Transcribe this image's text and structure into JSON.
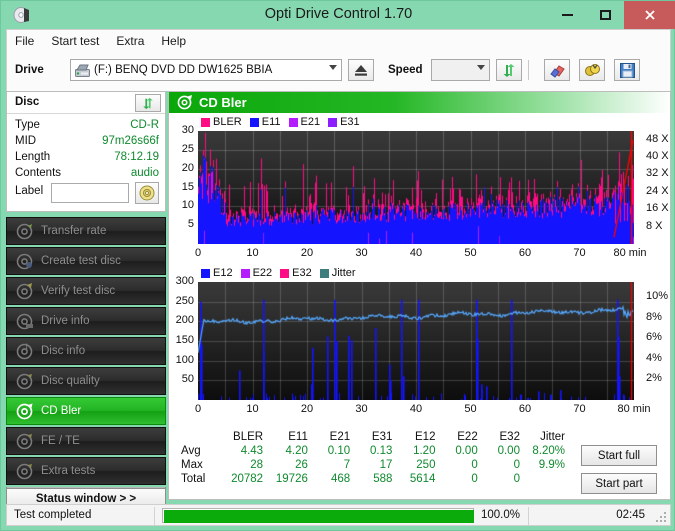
{
  "window": {
    "title": "Opti Drive Control 1.70",
    "icon": "disc-icon",
    "minimize": "–",
    "maximize": "□",
    "close": "✕"
  },
  "menu": {
    "items": [
      "File",
      "Start test",
      "Extra",
      "Help"
    ]
  },
  "toolbar": {
    "drive_label": "Drive",
    "drive_value": "(F:)  BENQ DVD DD DW1625 BBIA",
    "eject_icon": "eject-icon",
    "speed_label": "Speed",
    "speed_value": "",
    "refresh_icon": "refresh-icon",
    "eraser_icon": "eraser-icon",
    "coins_icon": "coins-icon",
    "save_icon": "floppy-save-icon"
  },
  "disc": {
    "header": "Disc",
    "swap_icon": "swap-arrows-icon",
    "rows": [
      {
        "key": "Type",
        "value": "CD-R"
      },
      {
        "key": "MID",
        "value": "97m26s66f"
      },
      {
        "key": "Length",
        "value": "78:12.19"
      },
      {
        "key": "Contents",
        "value": "audio"
      }
    ],
    "label_key": "Label",
    "label_value": "",
    "label_button_icon": "disc-icon"
  },
  "nav": {
    "items": [
      {
        "label": "Transfer rate",
        "icon": "disc-icon",
        "active": false
      },
      {
        "label": "Create test disc",
        "icon": "disc-icon",
        "active": false
      },
      {
        "label": "Verify test disc",
        "icon": "disc-icon",
        "active": false
      },
      {
        "label": "Drive info",
        "icon": "disc-icon",
        "active": false
      },
      {
        "label": "Disc info",
        "icon": "disc-icon",
        "active": false
      },
      {
        "label": "Disc quality",
        "icon": "disc-icon",
        "active": false
      },
      {
        "label": "CD Bler",
        "icon": "disc-icon",
        "active": true
      },
      {
        "label": "FE / TE",
        "icon": "disc-icon",
        "active": false
      },
      {
        "label": "Extra tests",
        "icon": "disc-icon",
        "active": false
      }
    ],
    "status_window": "Status window > >"
  },
  "main": {
    "header": "CD Bler",
    "header_icon": "disc-icon",
    "start_full": "Start full",
    "start_part": "Start part"
  },
  "statusbar": {
    "text": "Test completed",
    "percent_label": "100.0%",
    "percent_value": 100.0,
    "time": "02:45"
  },
  "stats": {
    "columns": [
      "BLER",
      "E11",
      "E21",
      "E31",
      "E12",
      "E22",
      "E32",
      "Jitter"
    ],
    "rows": [
      {
        "label": "Avg",
        "values": [
          "4.43",
          "4.20",
          "0.10",
          "0.13",
          "1.20",
          "0.00",
          "0.00",
          "8.20%"
        ]
      },
      {
        "label": "Max",
        "values": [
          "28",
          "26",
          "7",
          "17",
          "250",
          "0",
          "0",
          "9.9%"
        ]
      },
      {
        "label": "Total",
        "values": [
          "20782",
          "19726",
          "468",
          "588",
          "5614",
          "0",
          "0",
          ""
        ]
      }
    ]
  },
  "colors": {
    "bler": "#ff0c86",
    "e11": "#1414ff",
    "e21": "#b41eff",
    "e31": "#8c1eff",
    "e12": "#1414ff",
    "e22": "#b41eff",
    "e32": "#ff0c86",
    "jitter": "#3d7d7d",
    "speed_line": "#ff0000",
    "jitter_line": "#55a8ff",
    "accent_green": "#0cab0c",
    "value_green": "#0f8a2e",
    "titlebar": "#86d8b0"
  },
  "chart_data": [
    {
      "id": "bler-chart",
      "type": "bar",
      "title": "",
      "xlabel": "min",
      "ylabel": "",
      "xlim": [
        0,
        80
      ],
      "ylim": [
        0,
        30
      ],
      "xticks": [
        0,
        10,
        20,
        30,
        40,
        50,
        60,
        70,
        80
      ],
      "xticklabels": [
        "0",
        "10",
        "20",
        "30",
        "40",
        "50",
        "60",
        "70",
        "80 min"
      ],
      "yticks": [
        5,
        10,
        15,
        20,
        25,
        30
      ],
      "yticklabels": [
        "5",
        "10",
        "15",
        "20",
        "25",
        "30"
      ],
      "y2label": "X",
      "y2lim": [
        0,
        52
      ],
      "y2ticks": [
        8,
        16,
        24,
        32,
        40,
        48
      ],
      "y2ticklabels": [
        "8 X",
        "16 X",
        "24 X",
        "32 X",
        "40 X",
        "48 X"
      ],
      "grid": true,
      "legend": [
        {
          "name": "BLER",
          "color": "#ff0c86"
        },
        {
          "name": "E11",
          "color": "#1414ff"
        },
        {
          "name": "E21",
          "color": "#b41eff"
        },
        {
          "name": "E31",
          "color": "#8c1eff"
        }
      ],
      "series": [
        {
          "name": "BLER",
          "color": "#ff0c86",
          "avg": 4.43,
          "max": 28,
          "total": 20782
        },
        {
          "name": "E11",
          "color": "#1414ff",
          "avg": 4.2,
          "max": 26,
          "total": 19726
        },
        {
          "name": "E21",
          "color": "#b41eff",
          "avg": 0.1,
          "max": 7,
          "total": 468
        },
        {
          "name": "E31",
          "color": "#8c1eff",
          "avg": 0.13,
          "max": 17,
          "total": 588
        }
      ],
      "notes": "BLER (pink) overlaid on E11 (blue) dense spikes across 0-80 min; baseline ~5-10, spikes up to 28. Red speed curve ramps at end near 80 min."
    },
    {
      "id": "e12-jitter-chart",
      "type": "line",
      "title": "",
      "xlabel": "min",
      "ylabel": "",
      "xlim": [
        0,
        80
      ],
      "ylim": [
        0,
        300
      ],
      "xticks": [
        0,
        10,
        20,
        30,
        40,
        50,
        60,
        70,
        80
      ],
      "xticklabels": [
        "0",
        "10",
        "20",
        "30",
        "40",
        "50",
        "60",
        "70",
        "80 min"
      ],
      "yticks": [
        50,
        100,
        150,
        200,
        250,
        300
      ],
      "yticklabels": [
        "50",
        "100",
        "150",
        "200",
        "250",
        "300"
      ],
      "y2label": "%",
      "y2lim": [
        0,
        11.5
      ],
      "y2ticks": [
        2,
        4,
        6,
        8,
        10
      ],
      "y2ticklabels": [
        "2%",
        "4%",
        "6%",
        "8%",
        "10%"
      ],
      "grid": true,
      "legend": [
        {
          "name": "E12",
          "color": "#1414ff"
        },
        {
          "name": "E22",
          "color": "#b41eff"
        },
        {
          "name": "E32",
          "color": "#ff0c86"
        },
        {
          "name": "Jitter",
          "color": "#3d7d7d"
        }
      ],
      "series": [
        {
          "name": "E12",
          "color": "#1414ff",
          "avg": 1.2,
          "max": 250,
          "total": 5614
        },
        {
          "name": "E22",
          "color": "#b41eff",
          "avg": 0.0,
          "max": 0,
          "total": 0
        },
        {
          "name": "E32",
          "color": "#ff0c86",
          "avg": 0.0,
          "max": 0,
          "total": 0
        },
        {
          "name": "Jitter",
          "color": "#55a8ff",
          "avg": "8.20%",
          "max": "9.9%",
          "total": ""
        }
      ],
      "notes": "Jitter light-blue trace rises from ~7.7% at start to ~9% near end (right axis). Sparse tall blue E12 spikes up to 250."
    }
  ]
}
